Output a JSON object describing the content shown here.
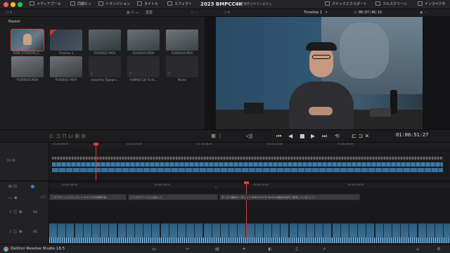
{
  "top_bar": {
    "tabs": [
      {
        "label": "メディアプール",
        "icon": "media-pool-icon"
      },
      {
        "label": "同期ビン",
        "icon": "sync-bin-icon"
      },
      {
        "label": "トランジション",
        "icon": "transition-icon"
      },
      {
        "label": "タイトル",
        "icon": "title-icon"
      },
      {
        "label": "エフェクト",
        "icon": "effects-icon"
      }
    ],
    "project_title": "2023 BMPCC4K",
    "save_status": "変更が保存されていません",
    "right_items": [
      {
        "label": "クイックエクスポート",
        "icon": "export-icon"
      },
      {
        "label": "フルスクリーン",
        "icon": "fullscreen-icon"
      },
      {
        "label": "インスペクタ",
        "icon": "inspector-icon"
      }
    ],
    "window_dots": [
      "#ff5f57",
      "#febc2e",
      "#28c840"
    ]
  },
  "sub_bar": {
    "sort_label": "並替",
    "timeline_name": "Timeline 1",
    "timecode": "00:07:46:15"
  },
  "media_pool": {
    "bin_label": "Master",
    "clips": [
      {
        "name": "A008_07081056_C...",
        "selected": true
      },
      {
        "name": "Timeline 1"
      },
      {
        "name": "P1000422.MOV"
      },
      {
        "name": "P1000423.MOV"
      },
      {
        "name": "P1000424.MOV"
      },
      {
        "name": "P1000425.MOV"
      },
      {
        "name": "P1000427.MOV"
      },
      {
        "name": "mjourney Typogra..."
      },
      {
        "name": "mitBHD Call To Ac..."
      },
      {
        "name": "Niceo"
      }
    ]
  },
  "viewer": {
    "timecode": "01:00:51:27"
  },
  "timeline_top": {
    "ruler_ticks": [
      "01:00:00:00",
      "01:01:24:00",
      "01:02:48:00",
      "01:04:12:00",
      "01:05:36:00"
    ]
  },
  "timeline_bottom": {
    "ruler_ticks": [
      "01:00:48:00",
      "01:00:50:00",
      "01:00:52:00",
      "01:00:54:00"
    ],
    "track_labels": [
      "ST1",
      "V2",
      "V1"
    ],
    "subtitle_clips": [
      "このワタリックカウンテンツ からプロの映像作家...",
      "ビデオグラフィカと出会って。",
      "多くまで最後の一歩として BMPCC4K を YouTube動画の制作に使用しているという..."
    ]
  },
  "bottom_bar": {
    "brand": "DaVinci Resolve Studio 18.5",
    "page_icons": [
      "media-page-icon",
      "cut-page-icon",
      "edit-page-icon",
      "fusion-page-icon",
      "color-page-icon",
      "fairlight-page-icon",
      "deliver-page-icon",
      "home-icon",
      "settings-icon"
    ]
  }
}
